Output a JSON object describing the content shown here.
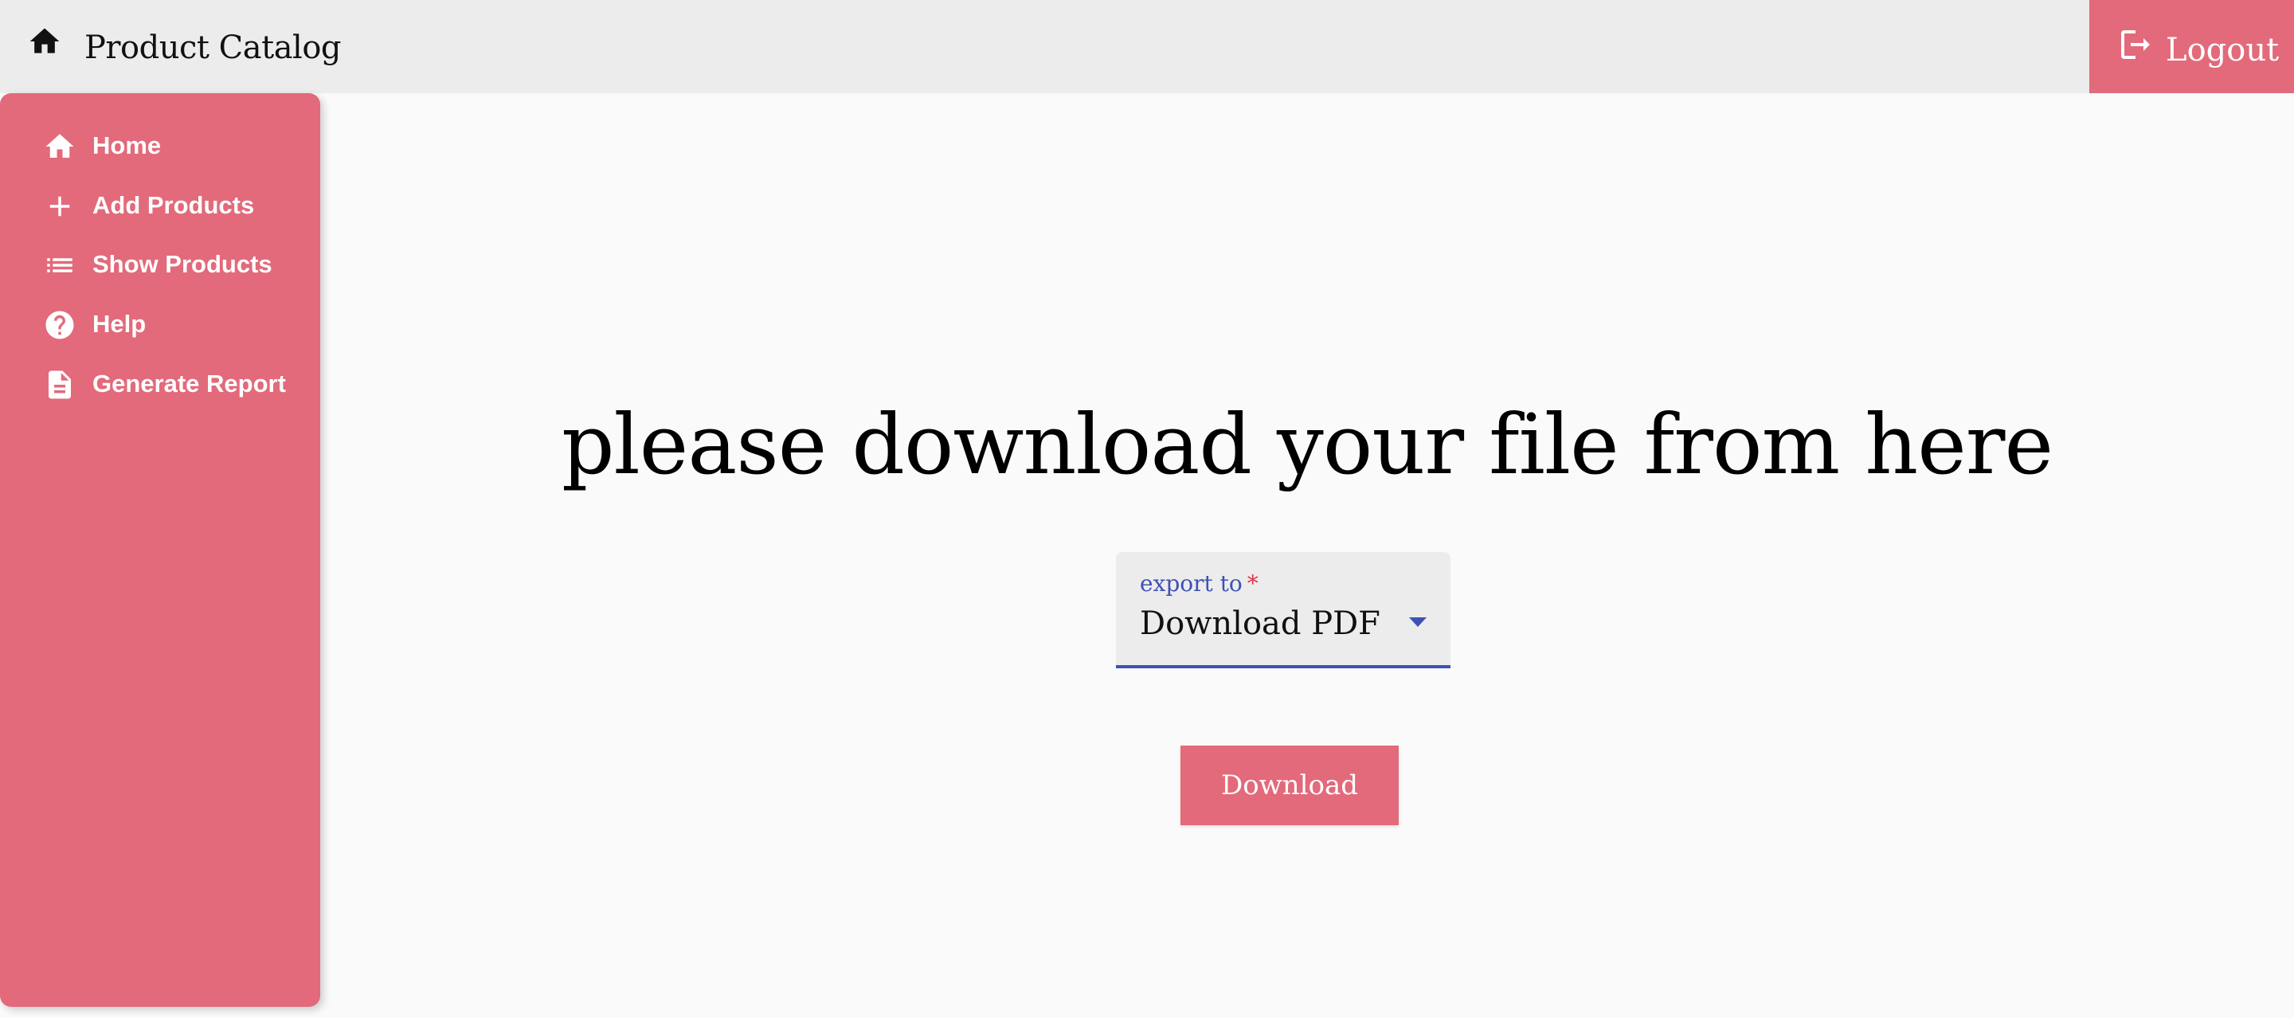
{
  "header": {
    "title": "Product Catalog",
    "logout_label": "Logout"
  },
  "sidebar": {
    "items": [
      {
        "label": "Home",
        "icon": "home-icon"
      },
      {
        "label": "Add Products",
        "icon": "plus-icon"
      },
      {
        "label": "Show Products",
        "icon": "list-icon"
      },
      {
        "label": "Help",
        "icon": "help-circle-icon"
      },
      {
        "label": "Generate Report",
        "icon": "document-icon"
      }
    ]
  },
  "main": {
    "headline": "please download your file from here",
    "export_select": {
      "label": "export to",
      "required_mark": "*",
      "value": "Download PDF"
    },
    "download_label": "Download"
  },
  "colors": {
    "accent": "#e26a7b",
    "topbar_bg": "#ececec",
    "page_bg": "#fafafa",
    "select_focus": "#3f51b5"
  }
}
